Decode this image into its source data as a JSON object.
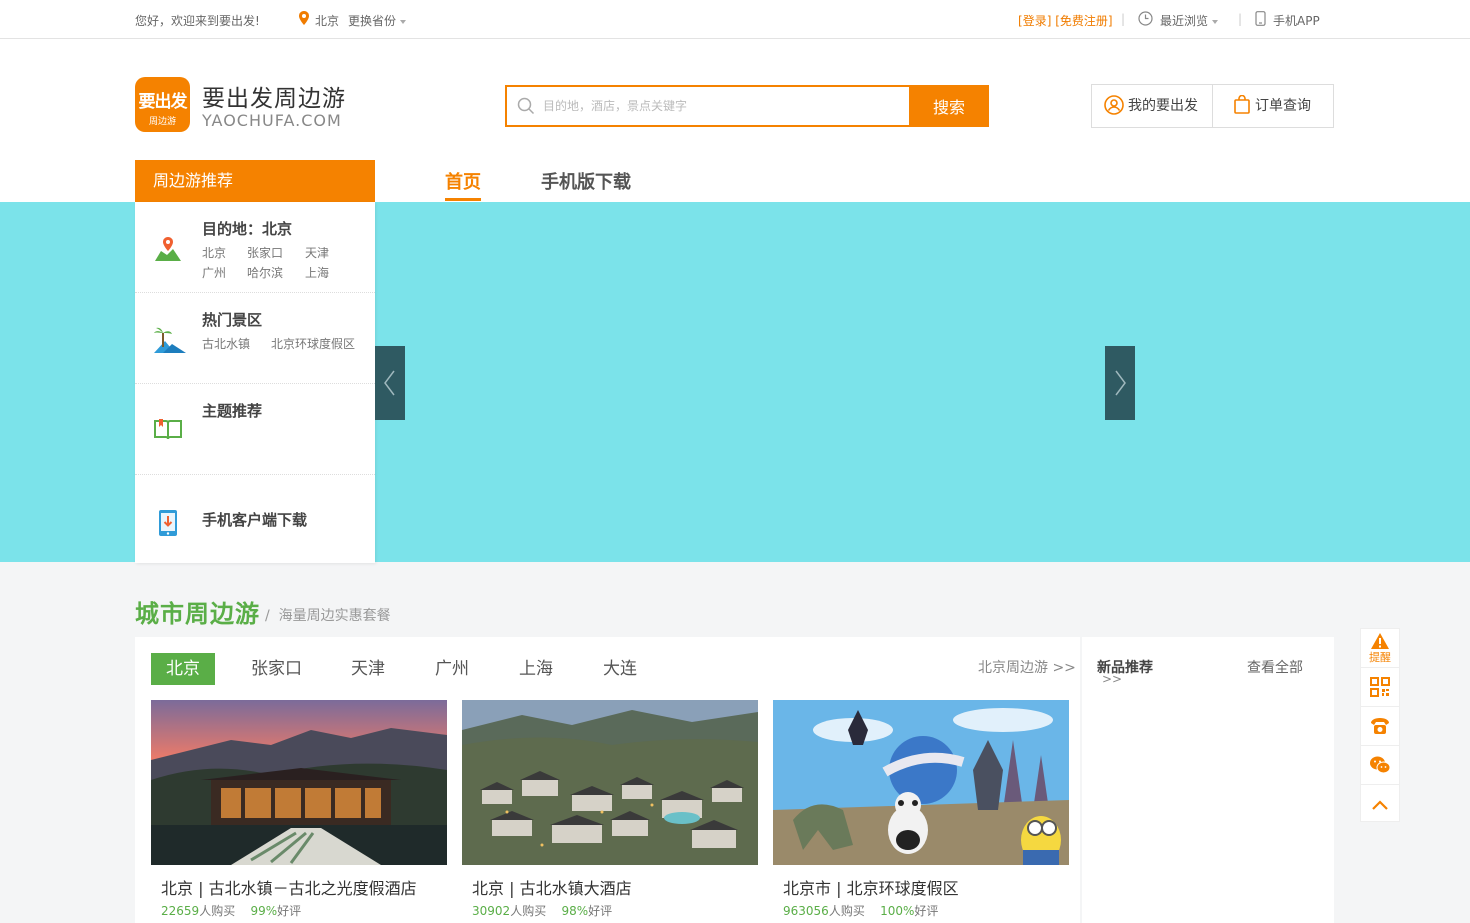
{
  "topbar": {
    "welcome": "您好，欢迎来到要出发!",
    "city": "北京",
    "change_province": "更换省份",
    "login": "登录",
    "register": "免费注册",
    "recent": "最近浏览",
    "mobile_app": "手机APP"
  },
  "logo": {
    "badge_line1": "要出发",
    "badge_line2": "周边游",
    "title": "要出发周边游",
    "subtitle": "YAOCHUFA.COM"
  },
  "search": {
    "placeholder": "目的地，酒店，景点关键字",
    "button": "搜索"
  },
  "user": {
    "my": "我的要出发",
    "orders": "订单查询"
  },
  "nav": {
    "home": "首页",
    "mobile": "手机版下载"
  },
  "side": {
    "header": "周边游推荐",
    "destination": {
      "title": "目的地：北京",
      "links": [
        "北京",
        "张家口",
        "天津",
        "广州",
        "哈尔滨",
        "上海"
      ]
    },
    "hot": {
      "title": "热门景区",
      "links": [
        "古北水镇",
        "北京环球度假区"
      ]
    },
    "theme": {
      "title": "主题推荐"
    },
    "app": {
      "title": "手机客户端下载"
    }
  },
  "section": {
    "title": "城市周边游",
    "slash": "/",
    "subtitle": "海量周边实惠套餐",
    "tabs": [
      "北京",
      "张家口",
      "天津",
      "广州",
      "上海",
      "大连"
    ],
    "more": "北京周边游  >>",
    "products": [
      {
        "name": "北京 | 古北水镇－古北之光度假酒店",
        "buyers": "22659",
        "buy_suffix": "人购买",
        "rating": "99%",
        "rating_suffix": "好评"
      },
      {
        "name": "北京 | 古北水镇大酒店",
        "buyers": "30902",
        "buy_suffix": "人购买",
        "rating": "98%",
        "rating_suffix": "好评"
      },
      {
        "name": "北京市 | 北京环球度假区",
        "buyers": "963056",
        "buy_suffix": "人购买",
        "rating": "100%",
        "rating_suffix": "好评"
      }
    ]
  },
  "new_products": {
    "title": "新品推荐",
    "arrows": ">>",
    "view_all": "查看全部"
  },
  "float": {
    "remind": "提醒"
  },
  "colors": {
    "accent": "#f58200",
    "green": "#5aae47",
    "banner": "#7be3ea"
  }
}
